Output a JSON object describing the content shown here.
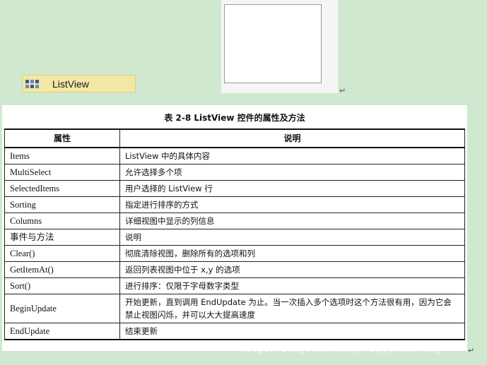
{
  "toolbox": {
    "icon": "listview-icon",
    "label": "ListView"
  },
  "paragraph_mark": "↵",
  "table": {
    "caption": "表 2-8   ListView 控件的属性及方法",
    "headers": [
      "属性",
      "说明"
    ],
    "rows": [
      {
        "name": "Items",
        "desc": "ListView 中的具体内容"
      },
      {
        "name": "MultiSelect",
        "desc": "允许选择多个项"
      },
      {
        "name": "SelectedItems",
        "desc": "用户选择的 ListView 行"
      },
      {
        "name": "Sorting",
        "desc": "指定进行排序的方式"
      },
      {
        "name": "Columns",
        "desc": "详细视图中显示的列信息"
      },
      {
        "name": "事件与方法",
        "desc": "说明"
      },
      {
        "name": "Clear()",
        "desc": "彻底清除视图，删除所有的选项和列"
      },
      {
        "name": "GetItemAt()",
        "desc": "返回列表视图中位于 x,y 的选项"
      },
      {
        "name": "Sort()",
        "desc": "进行排序：仅限于字母数字类型"
      },
      {
        "name": "BeginUpdate",
        "desc": "开始更新，直到调用 EndUpdate 为止。当一次插入多个选项时这个方法很有用，因为它会禁止视图闪烁，并可以大大提高速度"
      },
      {
        "name": "EndUpdate",
        "desc": "结束更新"
      }
    ]
  },
  "watermark": "http://blog.csdn.net/ruoyunliufeng"
}
